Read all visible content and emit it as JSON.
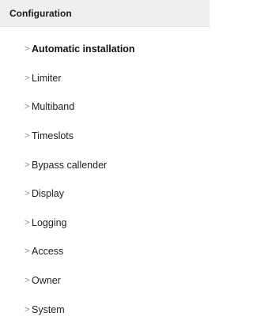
{
  "header": {
    "title": "Configuration"
  },
  "menu": {
    "chevron": ">",
    "items": [
      {
        "label": "Automatic installation",
        "active": true
      },
      {
        "label": "Limiter",
        "active": false
      },
      {
        "label": "Multiband",
        "active": false
      },
      {
        "label": "Timeslots",
        "active": false
      },
      {
        "label": "Bypass callender",
        "active": false
      },
      {
        "label": "Display",
        "active": false
      },
      {
        "label": "Logging",
        "active": false
      },
      {
        "label": "Access",
        "active": false
      },
      {
        "label": "Owner",
        "active": false
      },
      {
        "label": "System",
        "active": false
      }
    ]
  }
}
